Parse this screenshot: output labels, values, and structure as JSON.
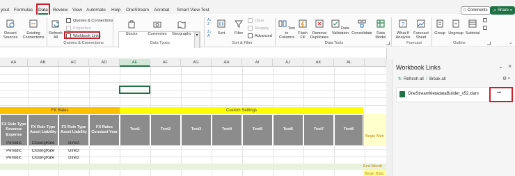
{
  "menu": {
    "items": [
      "yout",
      "Formulas",
      "Data",
      "Review",
      "View",
      "Automate",
      "Help",
      "OneStream",
      "Acrobat",
      "Smart View Test"
    ],
    "active": "Data",
    "comments_label": "Comments",
    "share_label": "Share"
  },
  "ribbon": {
    "get_data": {
      "recent_sources": "Recent Sources",
      "existing_connections": "Existing Connections"
    },
    "queries": {
      "refresh_all": "Refresh All",
      "queries_connections": "Queries & Connections",
      "properties": "Properties",
      "workbook_links": "Workbook Links",
      "group_label": "Queries & Connections"
    },
    "data_types": {
      "items": [
        "Stocks",
        "Currencies",
        "Geography"
      ],
      "group_label": "Data Types"
    },
    "sort_filter": {
      "sort": "Sort",
      "filter": "Filter",
      "clear": "Clear",
      "reapply": "Reapply",
      "advanced": "Advanced",
      "group_label": "Sort & Filter"
    },
    "data_tools": {
      "text_to_columns": "Text to Columns",
      "flash_fill": "Flash Fill",
      "remove_duplicates": "Remove Duplicates",
      "data_validation": "Data Validation",
      "consolidate": "Consolidate",
      "data_model": "Data Model",
      "group_label": "Data Tools"
    },
    "forecast": {
      "what_if": "What-If Analysis",
      "forecast_sheet": "Forecast Sheet",
      "group_label": "Forecast"
    },
    "outline": {
      "group": "Group",
      "ungroup": "Ungroup",
      "subtotal": "Subtotal",
      "group_label": "Outline"
    }
  },
  "grid": {
    "columns": [
      "AA",
      "AB",
      "AC",
      "AD",
      "AE",
      "AF",
      "AG",
      "AH",
      "AI",
      "AJ",
      "AK",
      "AL"
    ],
    "selected_column": "AE",
    "fx_rates_label": "FX Rates",
    "custom_settings_label": "Custom Settings",
    "headers": [
      "FX Rule Type Revenue Expense",
      "FX Rule Type Asset Liability",
      "FX Rule Type Asset Liability",
      "FX Rates Constant Year",
      "Text1",
      "Text2",
      "Text3",
      "Text4",
      "Text5",
      "Text6",
      "Text7",
      "Text8"
    ],
    "rows": [
      [
        "Periodic",
        "ClosingRate",
        "Direct"
      ],
      [
        "Periodic",
        "ClosingRate",
        "Direct"
      ],
      [
        "Periodic",
        "ClosingRate",
        "Direct"
      ]
    ],
    "begin_label": "Begin Men",
    "end_label": "End Memb",
    "begin_bala_label": "Begin Bala"
  },
  "pane": {
    "title": "Workbook Links",
    "refresh_all": "Refresh all",
    "break_all": "Break all",
    "file_name": "OneStreamMetadataBuilder_v52.xlam",
    "more": "•••"
  },
  "colors": {
    "accent_green": "#217346",
    "highlight_red": "#c8202f",
    "band_yellow": "#ffd23f",
    "header_gray": "#8c8c8c"
  }
}
